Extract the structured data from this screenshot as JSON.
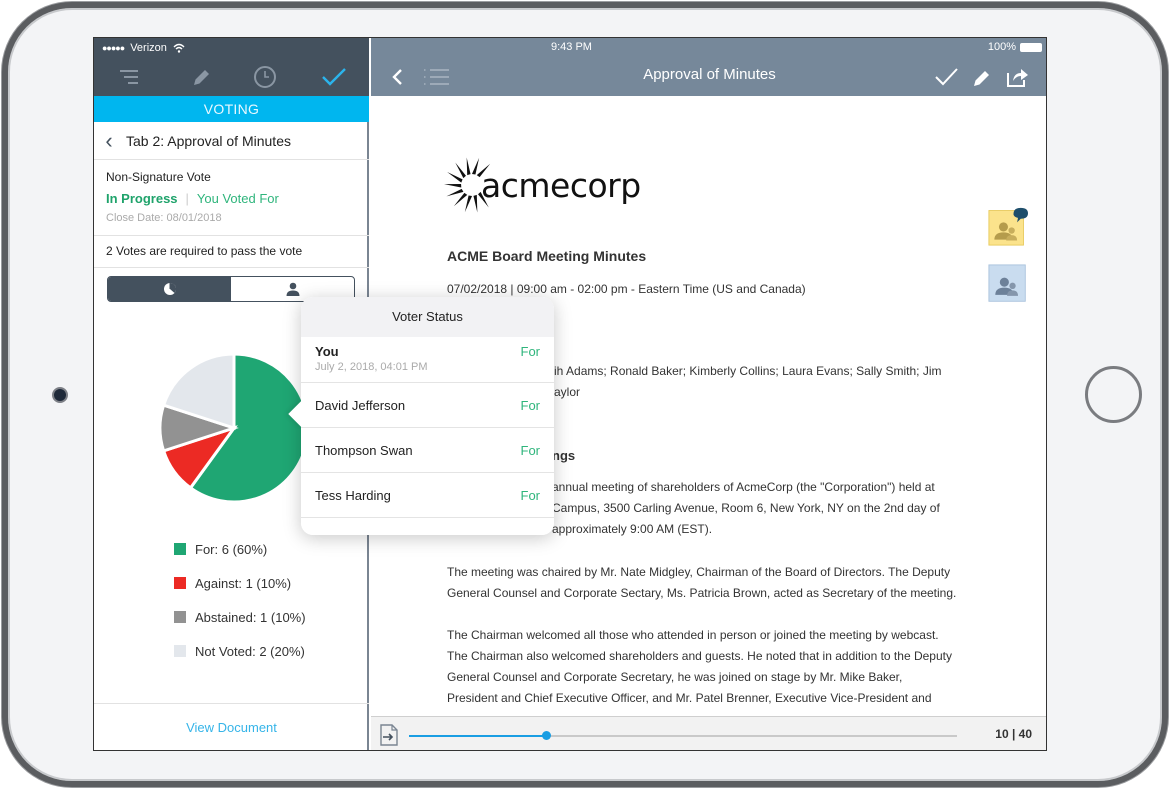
{
  "left_panel": {
    "status_bar": {
      "signal": "●●●●●",
      "carrier": "Verizon"
    },
    "toolbar": {
      "icons": [
        "menu-icon",
        "pencil-icon",
        "clock-icon",
        "checkmark-icon"
      ]
    },
    "section_label": "VOTING",
    "tab_title": "Tab 2: Approval of Minutes",
    "vote": {
      "type": "Non-Signature Vote",
      "status": "In Progress",
      "user_vote": "You Voted For",
      "close_date": "Close Date: 08/01/2018"
    },
    "votes_required": "2 Votes are required to pass the vote",
    "segments": [
      "chart-view",
      "voter-view"
    ],
    "legend": [
      {
        "label": "For: 6 (60%)",
        "color": "#1fa673"
      },
      {
        "label": "Against: 1 (10%)",
        "color": "#ec2a24"
      },
      {
        "label": "Abstained: 1 (10%)",
        "color": "#929292"
      },
      {
        "label": "Not Voted: 2 (20%)",
        "color": "#e3e7ec"
      }
    ],
    "footer_link": "View Document"
  },
  "chart_data": {
    "type": "pie",
    "title": "",
    "categories": [
      "For",
      "Against",
      "Abstained",
      "Not Voted"
    ],
    "values": [
      6,
      1,
      1,
      2
    ],
    "percentages": [
      60,
      10,
      10,
      20
    ],
    "colors": [
      "#1fa673",
      "#ec2a24",
      "#929292",
      "#e3e7ec"
    ],
    "legend_position": "bottom"
  },
  "right_panel": {
    "status_bar": {
      "time": "9:43 PM",
      "battery": "100%"
    },
    "title": "Approval of Minutes",
    "document": {
      "logo_text": "acmecorp",
      "heading": "ACME Board Meeting Minutes",
      "date_line": "07/02/2018 | 09:00 am - 02:00 pm - Eastern Time (US and Canada)",
      "attendees_line1": "ih Adams; Ronald Baker; Kimberly Collins; Laura Evans; Sally Smith; Jim",
      "attendees_line2": "aylor",
      "section_heading": "ngs",
      "para1_line1": "annual meeting of shareholders of AcmeCorp (the \"Corporation\") held at",
      "para1_line2": "Campus, 3500 Carling Avenue, Room 6, New York, NY on the 2nd day of",
      "para1_line3": "approximately 9:00 AM (EST).",
      "para2_line1": "The meeting was chaired by Mr. Nate Midgley, Chairman of the Board of Directors. The Deputy",
      "para2_line2": "General Counsel and Corporate Sectary, Ms. Patricia Brown, acted as Secretary of the meeting.",
      "para3_line1": "The Chairman welcomed all those who attended in person or joined the meeting by webcast.",
      "para3_line2": "The Chairman also welcomed shareholders and guests. He noted that in addition to the Deputy",
      "para3_line3": "General Counsel and Corporate Secretary, he was joined on stage by Mr. Mike Baker,",
      "para3_line4": "President and Chief Executive Officer, and Mr. Patel Brenner, Executive Vice-President and"
    },
    "page_indicator": "10 | 40",
    "page_progress": 0.25,
    "accent_color": "#1a9ee3"
  },
  "voter_status": {
    "title": "Voter Status",
    "voters": [
      {
        "name": "You",
        "date": "July 2, 2018, 04:01 PM",
        "vote": "For"
      },
      {
        "name": "David Jefferson",
        "vote": "For"
      },
      {
        "name": "Thompson Swan",
        "vote": "For"
      },
      {
        "name": "Tess Harding",
        "vote": "For"
      }
    ]
  }
}
